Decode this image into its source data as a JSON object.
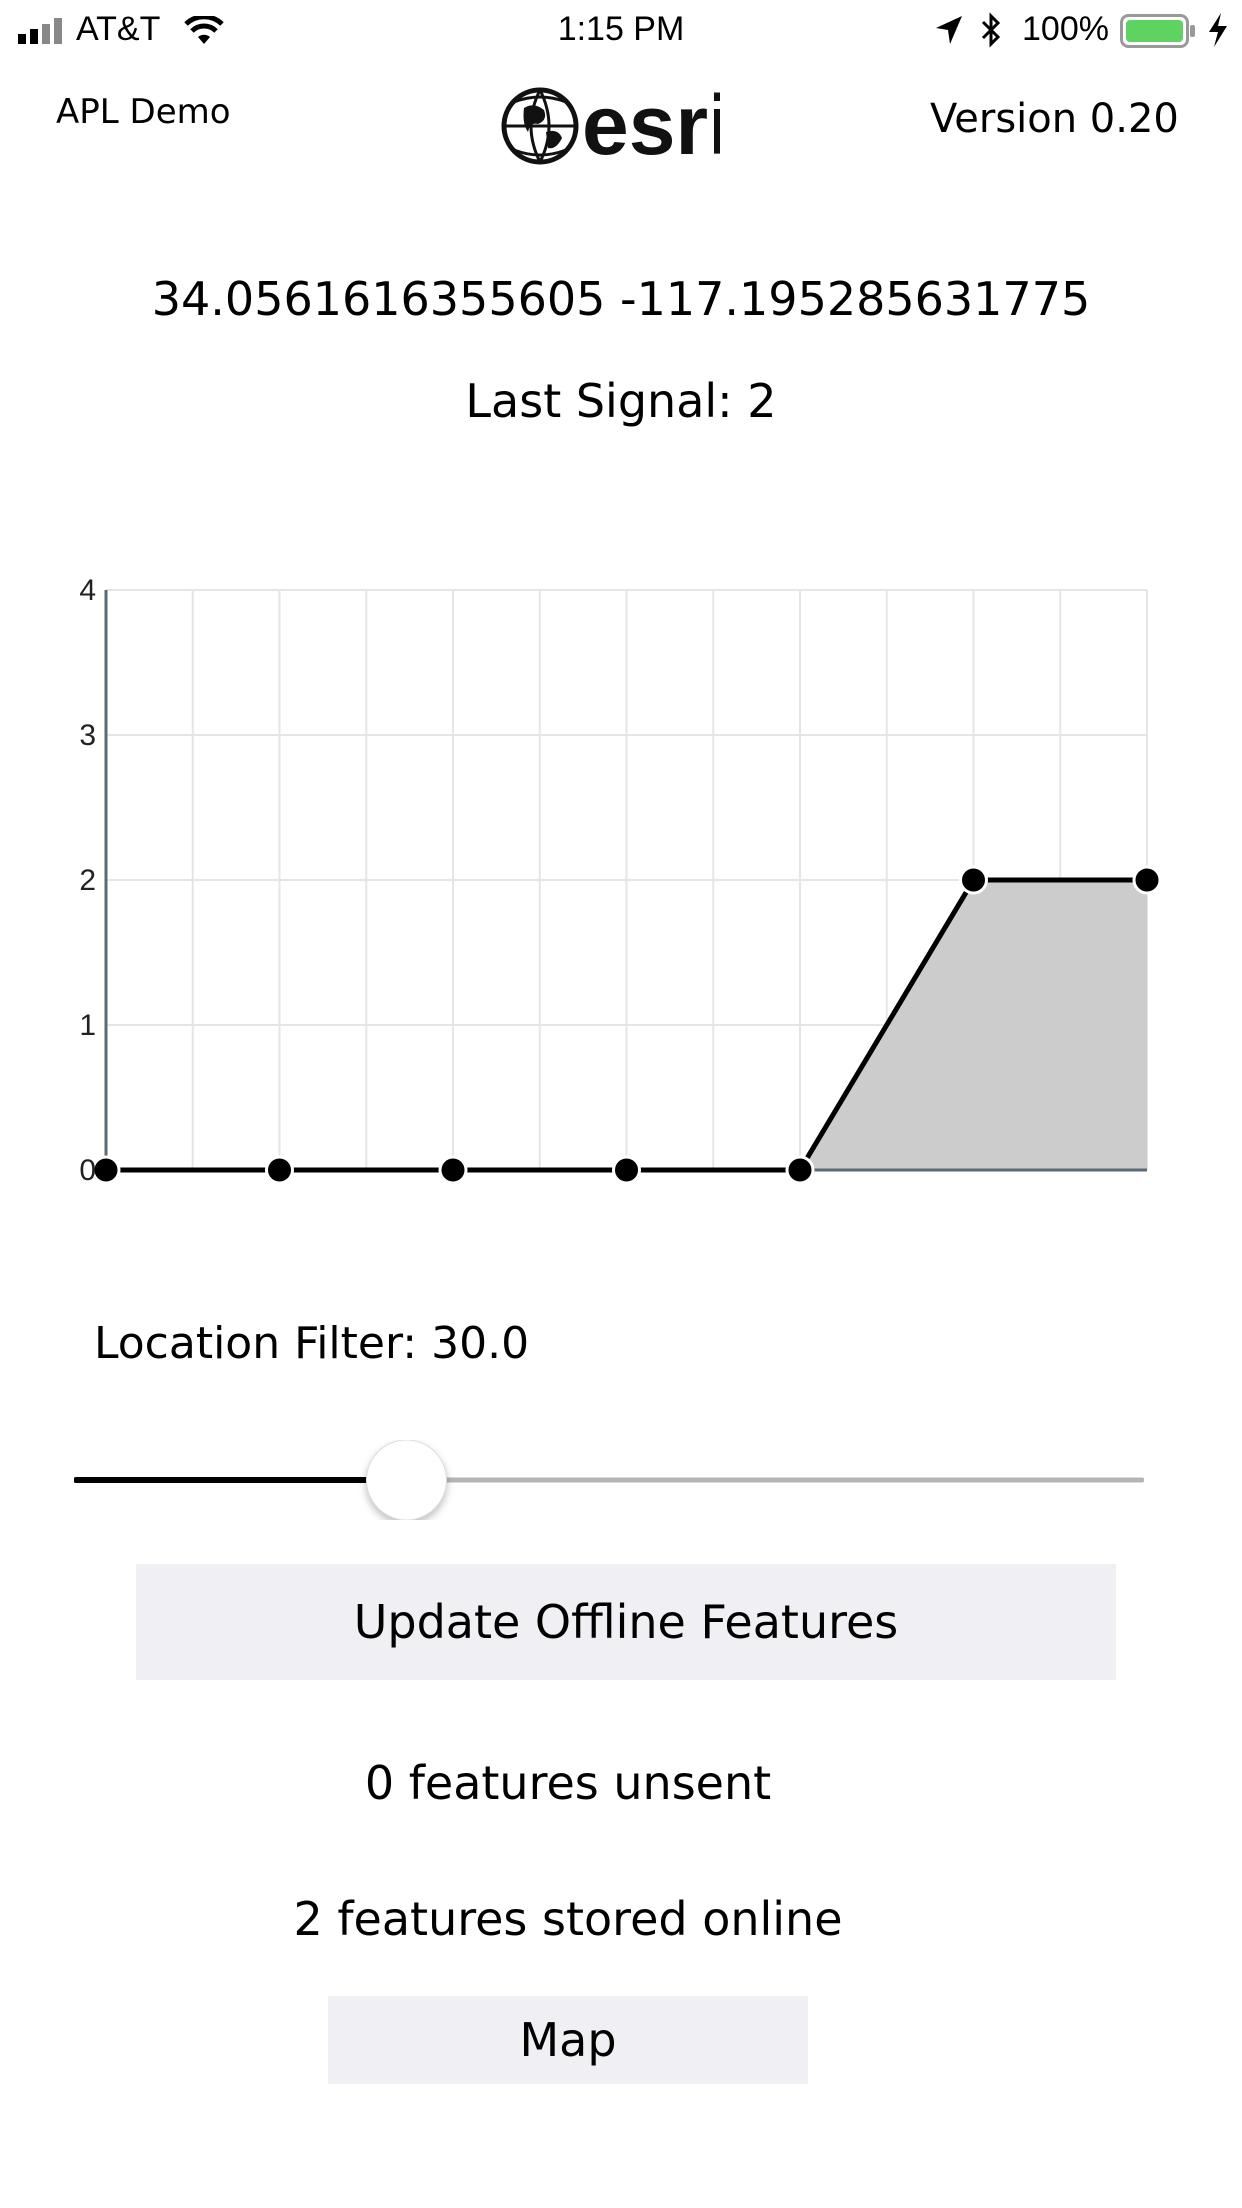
{
  "status_bar": {
    "carrier": "AT&T",
    "time": "1:15 PM",
    "battery": "100%"
  },
  "header": {
    "app_name": "APL Demo",
    "logo_text": "esri",
    "version": "Version 0.20"
  },
  "location": {
    "coordinates": "34.0561616355605 -117.195285631775",
    "last_signal": "Last Signal: 2"
  },
  "chart_data": {
    "type": "area",
    "x": [
      0,
      1,
      2,
      3,
      4,
      5,
      6
    ],
    "values": [
      0,
      0,
      0,
      0,
      0,
      2,
      2
    ],
    "ylim": [
      0,
      4
    ],
    "yticks": [
      "0",
      "1",
      "2",
      "3",
      "4"
    ],
    "grid": true,
    "legend": "none",
    "colors": {
      "line": "#000000",
      "fill": "#cccccc",
      "grid": "#e5e5e5",
      "axis": "#5b6a75"
    }
  },
  "filter": {
    "label": "Location Filter:  30.0",
    "slider_fraction": 0.31
  },
  "buttons": {
    "update": "Update Offline Features",
    "map": "Map"
  },
  "features": {
    "unsent": "0 features unsent",
    "online": "2 features stored online"
  },
  "icons": [
    "signal-bars-icon",
    "wifi-icon",
    "location-arrow-icon",
    "bluetooth-icon",
    "battery-icon",
    "charging-bolt-icon",
    "esri-globe-logo"
  ]
}
